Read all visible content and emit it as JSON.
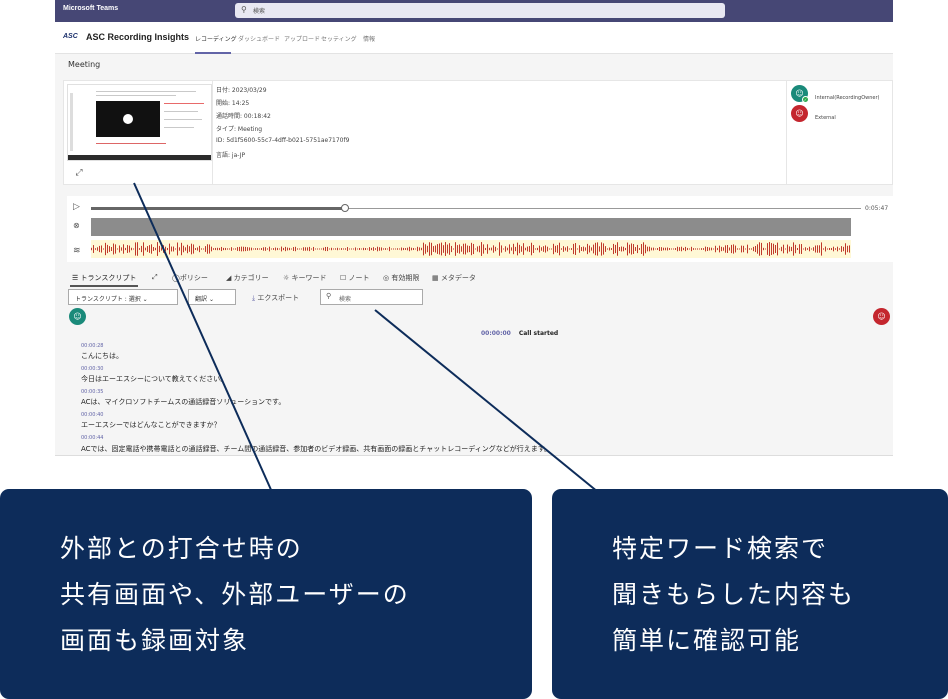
{
  "teams": {
    "title": "Microsoft Teams",
    "search_placeholder": "検索"
  },
  "app": {
    "logo": "ASC",
    "name": "ASC Recording Insights",
    "nav": [
      "レコーディング",
      "ダッシュボード",
      "アップロード",
      "セッティング",
      "情報"
    ]
  },
  "page_title": "Meeting",
  "meeting": {
    "date": "日付: 2023/03/29",
    "start": "開始: 14:25",
    "duration": "通話時間: 00:18:42",
    "type": "タイプ: Meeting",
    "id": "ID: 5d1f5600-55c7-4dff-b021-5751ae7170f9",
    "language": "言語: ja-JP"
  },
  "participants": [
    {
      "label": "Internal(RecordingOwner)",
      "color": "#1a8a7a"
    },
    {
      "label": "External",
      "color": "#c4262e"
    }
  ],
  "player": {
    "total_time": "0:05:47",
    "progress_fraction": 0.33
  },
  "tabs": [
    "トランスクリプト",
    "ポリシー",
    "カテゴリー",
    "キーワード",
    "ノート",
    "有効期限",
    "メタデータ"
  ],
  "toolbar": {
    "transcript_select": "トランスクリプト : 選択",
    "translate": "翻訳",
    "export": "エクスポート",
    "search_placeholder": "検索"
  },
  "call_started": {
    "time": "00:00:00",
    "label": "Call started"
  },
  "transcript": [
    {
      "time": "00:00:28",
      "text": "こんにちは。"
    },
    {
      "time": "00:00:30",
      "text": "今日はエーエスシーについて教えてください。"
    },
    {
      "time": "00:00:35",
      "text": "ACは、マイクロソフトチームスの通話録音ソリューションです。"
    },
    {
      "time": "00:00:40",
      "text": "エーエスシーではどんなことができますか？"
    },
    {
      "time": "00:00:44",
      "text": "ACでは、固定電話や携帯電話との通話録音、チーム間の通話録音、参加者のビデオ録画、共有画面の録画とチャットレコーディングなどが行えます。"
    }
  ],
  "callouts": {
    "left": [
      "外部との打合せ時の",
      "共有画面や、外部ユーザーの",
      "画面も録画対象"
    ],
    "right": [
      "特定ワード検索で",
      "聞きもらした内容も",
      "簡単に確認可能"
    ]
  },
  "colors": {
    "teams_bar": "#464775",
    "accent": "#6264a7",
    "callout_bg": "#0d2c5a",
    "waveform": "#c0392b"
  }
}
